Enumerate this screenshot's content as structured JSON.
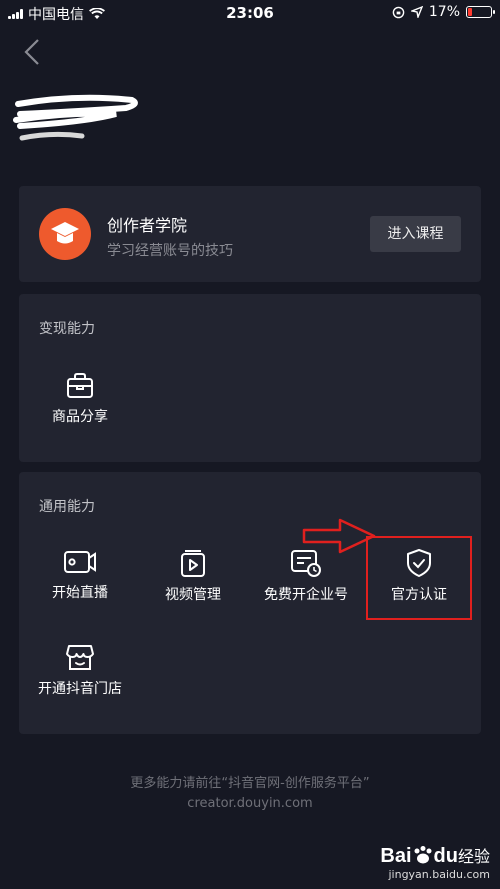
{
  "status_bar": {
    "carrier": "中国电信",
    "time": "23:06",
    "battery_percent": "17%",
    "battery_level": 0.17
  },
  "academy": {
    "title": "创作者学院",
    "subtitle": "学习经营账号的技巧",
    "button_label": "进入课程"
  },
  "monetization": {
    "section_title": "变现能力",
    "items": [
      {
        "label": "商品分享",
        "icon": "shopping-bag-icon"
      }
    ]
  },
  "general": {
    "section_title": "通用能力",
    "items": [
      {
        "label": "开始直播",
        "icon": "live-camera-icon"
      },
      {
        "label": "视频管理",
        "icon": "video-manage-icon"
      },
      {
        "label": "免费开企业号",
        "icon": "enterprise-card-icon"
      },
      {
        "label": "官方认证",
        "icon": "verified-shield-icon"
      },
      {
        "label": "开通抖音门店",
        "icon": "store-icon"
      }
    ]
  },
  "footer": {
    "line1": "更多能力请前往“抖音官网-创作服务平台”",
    "line2": "creator.douyin.com"
  },
  "watermark": {
    "logo": "Bai",
    "logo2": "du",
    "text": "经验",
    "url": "jingyan.baidu.com"
  },
  "colors": {
    "background": "#161823",
    "card": "#222430",
    "accent": "#ee5a2d",
    "annotation": "#e0201e"
  }
}
